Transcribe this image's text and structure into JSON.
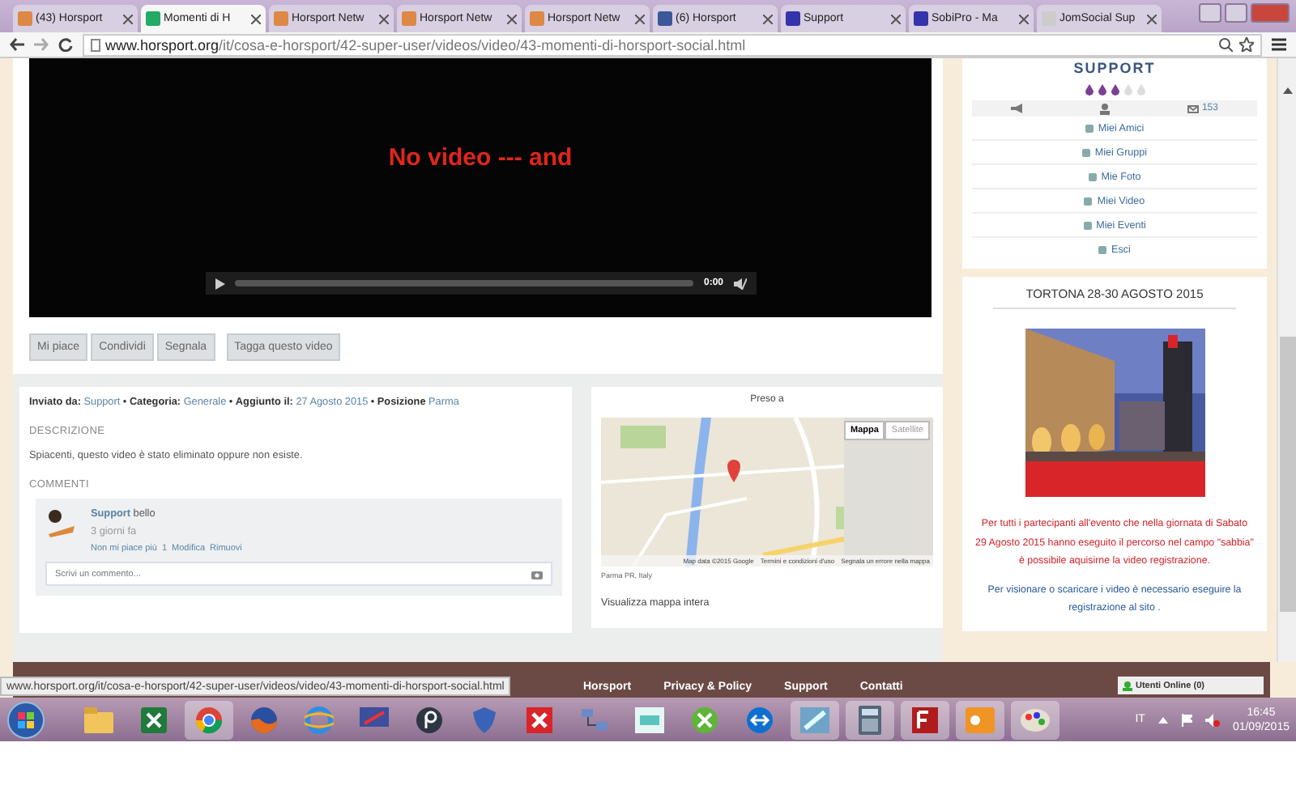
{
  "browser": {
    "tabs": [
      {
        "title": "(43) Horsport",
        "selected": false
      },
      {
        "title": "Momenti di H",
        "selected": true
      },
      {
        "title": "Horsport Netw",
        "selected": false
      },
      {
        "title": "Horsport Netw",
        "selected": false
      },
      {
        "title": "Horsport Netw",
        "selected": false
      },
      {
        "title": "(6) Horsport",
        "selected": false
      },
      {
        "title": "Support",
        "selected": false
      },
      {
        "title": "SobiPro - Ma",
        "selected": false
      },
      {
        "title": "JomSocial Sup",
        "selected": false
      }
    ],
    "address": {
      "domain": "www.horsport.org",
      "path": "/it/cosa-e-horsport/42-super-user/videos/video/43-momenti-di-horsport-social.html"
    }
  },
  "video": {
    "message": "No video --- and",
    "time": "0:00"
  },
  "video_actions": [
    "Mi piace",
    "Condividi",
    "Segnala",
    "Tagga questo video"
  ],
  "details": {
    "meta": [
      {
        "label": "Inviato da:",
        "value": "Support"
      },
      {
        "label": "Categoria:",
        "value": "Generale"
      },
      {
        "label": "Aggiunto il:",
        "value": "27 Agosto 2015"
      },
      {
        "label": "Posizione",
        "value": "Parma"
      }
    ],
    "meta_separator": "•",
    "description_heading": "DESCRIZIONE",
    "description": "Spiacenti, questo video è stato eliminato oppure non esiste.",
    "comments_heading": "COMMENTI",
    "comments": [
      {
        "author": "Support",
        "text": "bello",
        "time": "3 giorni fa",
        "actions": [
          "Non mi piace più",
          "1",
          "Modifica",
          "Rimuovi"
        ]
      }
    ],
    "comment_field": {
      "placeholder": "Scrivi un commento..."
    }
  },
  "map": {
    "title": "Preso a",
    "map_types": [
      {
        "label": "Mappa",
        "selected": true
      },
      {
        "label": "Satellite",
        "selected": false
      }
    ],
    "attribution": [
      "Map data ©2015 Google",
      "Termini e condizioni d'uso",
      "Segnala un errore nella mappa"
    ],
    "place": "Parma PR, Italy",
    "link": "Visualizza mappa intera"
  },
  "sidebar": {
    "profile": {
      "name": "SUPPORT",
      "stars": 3,
      "messages": "153",
      "menu": [
        "Miei Amici",
        "Miei Gruppi",
        "Mie Foto",
        "Miei Video",
        "Miei Eventi",
        "Esci"
      ]
    },
    "event": {
      "title": "TORTONA 28-30 AGOSTO 2015",
      "notice": "Per tutti i partecipanti all'evento che nella giornata di Sabato 29 Agosto 2015 hanno eseguito il percorso nel campo \"sabbia\" è possibile aquisirne la video registrazione.",
      "info": "Per visionare o scaricare i video è necessario eseguire la registrazione al sito ."
    }
  },
  "footer": {
    "links": [
      "Horsport",
      "Privacy & Policy",
      "Support",
      "Contatti"
    ],
    "chat": "Utenti Online (0)"
  },
  "status_url": "www.horsport.org/it/cosa-e-horsport/42-super-user/videos/video/43-momenti-di-horsport-social.html",
  "taskbar": {
    "language": "IT",
    "time": "16:45",
    "date": "01/09/2015"
  }
}
